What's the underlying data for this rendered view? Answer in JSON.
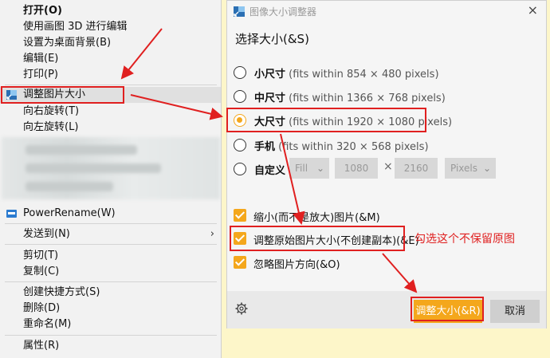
{
  "context_menu": {
    "items": [
      {
        "label": "打开(O)",
        "bold": true
      },
      {
        "label": "使用画图 3D 进行编辑"
      },
      {
        "label": "设置为桌面背景(B)"
      },
      {
        "label": "编辑(E)"
      },
      {
        "label": "打印(P)"
      },
      {
        "label": "调整图片大小"
      },
      {
        "label": "向右旋转(T)"
      },
      {
        "label": "向左旋转(L)"
      },
      {
        "label": "PowerRename(W)"
      },
      {
        "label": "发送到(N)"
      },
      {
        "label": "剪切(T)"
      },
      {
        "label": "复制(C)"
      },
      {
        "label": "创建快捷方式(S)"
      },
      {
        "label": "删除(D)"
      },
      {
        "label": "重命名(M)"
      },
      {
        "label": "属性(R)"
      }
    ],
    "submenu_arrow": "›"
  },
  "dialog": {
    "title": "图像大小调整器",
    "close_glyph": "×",
    "heading": "选择大小(&S)",
    "options": [
      {
        "name": "小尺寸",
        "desc": "(fits within 854 × 480 pixels)",
        "selected": false
      },
      {
        "name": "中尺寸",
        "desc": "(fits within 1366 × 768 pixels)",
        "selected": false
      },
      {
        "name": "大尺寸",
        "desc": "(fits within 1920 × 1080 pixels)",
        "selected": true
      },
      {
        "name": "手机",
        "desc": "(fits within 320 × 568 pixels)",
        "selected": false
      },
      {
        "name": "自定义",
        "desc": "",
        "selected": false
      }
    ],
    "custom": {
      "fit": "Fill",
      "width": "1080",
      "times": "×",
      "height": "2160",
      "unit": "Pixels",
      "chevron": "⌄"
    },
    "checkboxes": [
      {
        "label": "缩小(而不是放大)图片(&M)",
        "checked": true
      },
      {
        "label": "调整原始图片大小(不创建副本)(&E)",
        "checked": true
      },
      {
        "label": "忽略图片方向(&O)",
        "checked": true
      }
    ],
    "resize_button": "调整大小(&R)",
    "cancel_button": "取消"
  },
  "annotation": {
    "note": "勾选这个不保留原图",
    "color": "#e02020"
  },
  "colors": {
    "accent": "#f4a71c",
    "menu_bg": "#f2f2f2",
    "dialog_bg": "#f5f5f5",
    "page_bg": "#fdf6c9"
  }
}
